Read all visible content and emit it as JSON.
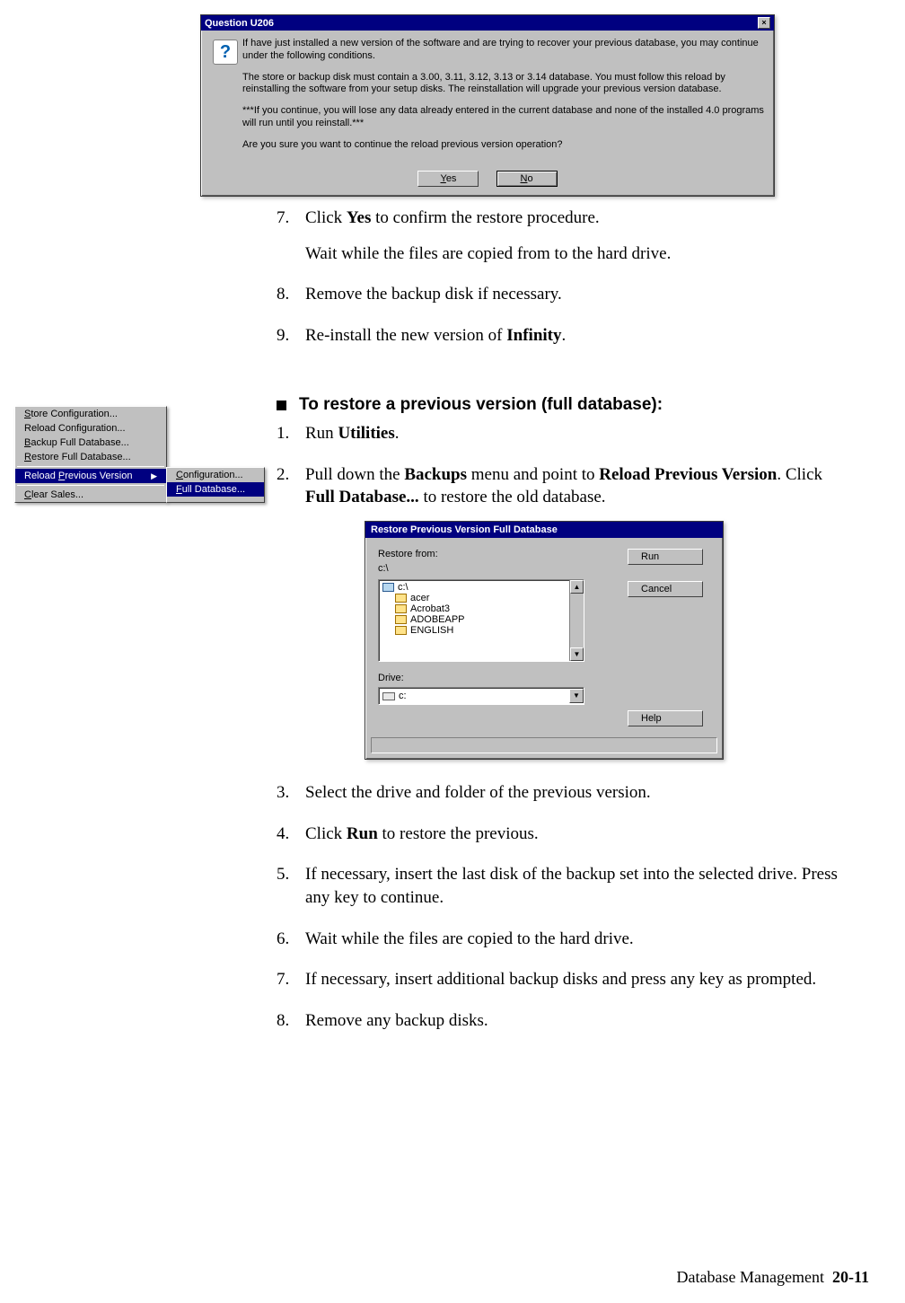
{
  "dialog1": {
    "title": "Question U206",
    "paragraphs": [
      "If have just installed a new version of the software and are trying to recover your previous database, you may continue under the following conditions.",
      "The store or backup disk must contain a 3.00, 3.11, 3.12, 3.13 or 3.14 database. You must follow this reload by reinstalling the software from your setup disks. The reinstallation will upgrade your previous version database.",
      "***If you continue, you will lose any data already entered in the current database and none of the installed 4.0 programs will run until you reinstall.***",
      "Are you sure you want to continue the reload previous version operation?"
    ],
    "yes": "Yes",
    "no": "No"
  },
  "stepsTop": [
    {
      "n": "7.",
      "pre": "Click ",
      "bold": "Yes",
      "post": " to confirm the restore procedure.",
      "sub": "Wait while the files are copied from to the hard drive."
    },
    {
      "n": "8.",
      "pre": "Remove the backup disk if necessary.",
      "bold": "",
      "post": ""
    },
    {
      "n": "9.",
      "pre": "Re-install the new version of ",
      "bold": "Infinity",
      "post": "."
    }
  ],
  "section_heading": "To restore a previous version (full database):",
  "sectionSteps": [
    {
      "n": "1.",
      "html": "Run <b>Utilities</b>."
    },
    {
      "n": "2.",
      "html": "Pull down the <b>Backups</b> menu and point to <b>Reload Previous Version</b>. Click <b>Full Database...</b> to restore the old database."
    }
  ],
  "menu": {
    "items": [
      {
        "label": "Store Configuration...",
        "ul": "S"
      },
      {
        "label": "Reload Configuration...",
        "ul": ""
      },
      {
        "label": "Backup Full Database...",
        "ul": "B"
      },
      {
        "label": "Restore Full Database...",
        "ul": "R"
      }
    ],
    "selected": {
      "label": "Reload Previous Version",
      "ul": "P"
    },
    "last": {
      "label": "Clear Sales...",
      "ul": "C"
    },
    "submenu": [
      {
        "label": "Configuration...",
        "ul": "C"
      },
      {
        "label": "Full Database...",
        "ul": "F",
        "sel": true
      }
    ]
  },
  "dialog2": {
    "title": "Restore Previous Version Full Database",
    "restore_label": "Restore from:",
    "path": "c:\\",
    "folders": [
      "c:\\",
      "acer",
      "Acrobat3",
      "ADOBEAPP",
      "ENGLISH"
    ],
    "drive_label": "Drive:",
    "drive_value": "c:",
    "run": "Run",
    "cancel": "Cancel",
    "help": "Help"
  },
  "stepsBot": [
    {
      "n": "3.",
      "html": "Select the drive and folder of the previous version."
    },
    {
      "n": "4.",
      "html": "Click <b>Run</b> to restore the previous."
    },
    {
      "n": "5.",
      "html": "If necessary, insert the last disk of the backup set into the selected drive. Press any key to continue."
    },
    {
      "n": "6.",
      "html": "Wait while the files are copied to the hard drive."
    },
    {
      "n": "7.",
      "html": "If necessary, insert additional backup disks and press any key as prompted."
    },
    {
      "n": "8.",
      "html": "Remove any backup disks."
    }
  ],
  "footer": {
    "section": "Database Management",
    "page": "20-11"
  }
}
